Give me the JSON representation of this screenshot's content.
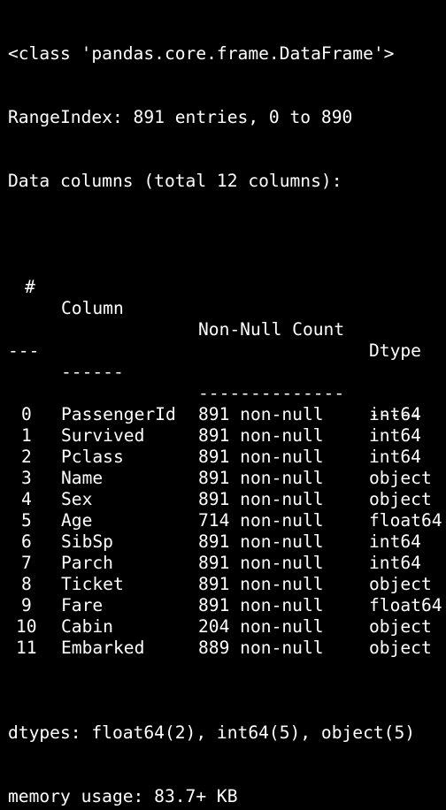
{
  "header_lines": [
    "<class 'pandas.core.frame.DataFrame'>",
    "RangeIndex: 891 entries, 0 to 890",
    "Data columns (total 12 columns):"
  ],
  "table": {
    "headers": {
      "num": "#",
      "column": "Column",
      "count": "Non-Null Count",
      "dtype": "Dtype"
    },
    "separators": {
      "num": "---",
      "column": "------",
      "count": "--------------",
      "dtype": "-----"
    },
    "rows": [
      {
        "num": "0",
        "column": "PassengerId",
        "count": "891 non-null",
        "dtype": "int64"
      },
      {
        "num": "1",
        "column": "Survived",
        "count": "891 non-null",
        "dtype": "int64"
      },
      {
        "num": "2",
        "column": "Pclass",
        "count": "891 non-null",
        "dtype": "int64"
      },
      {
        "num": "3",
        "column": "Name",
        "count": "891 non-null",
        "dtype": "object"
      },
      {
        "num": "4",
        "column": "Sex",
        "count": "891 non-null",
        "dtype": "object"
      },
      {
        "num": "5",
        "column": "Age",
        "count": "714 non-null",
        "dtype": "float64"
      },
      {
        "num": "6",
        "column": "SibSp",
        "count": "891 non-null",
        "dtype": "int64"
      },
      {
        "num": "7",
        "column": "Parch",
        "count": "891 non-null",
        "dtype": "int64"
      },
      {
        "num": "8",
        "column": "Ticket",
        "count": "891 non-null",
        "dtype": "object"
      },
      {
        "num": "9",
        "column": "Fare",
        "count": "891 non-null",
        "dtype": "float64"
      },
      {
        "num": "10",
        "column": "Cabin",
        "count": "204 non-null",
        "dtype": "object"
      },
      {
        "num": "11",
        "column": "Embarked",
        "count": "889 non-null",
        "dtype": "object"
      }
    ]
  },
  "footer_lines": [
    "dtypes: float64(2), int64(5), object(5)",
    "memory usage: 83.7+ KB"
  ],
  "colors": {
    "background": "#000000",
    "text": "#ffffff"
  }
}
